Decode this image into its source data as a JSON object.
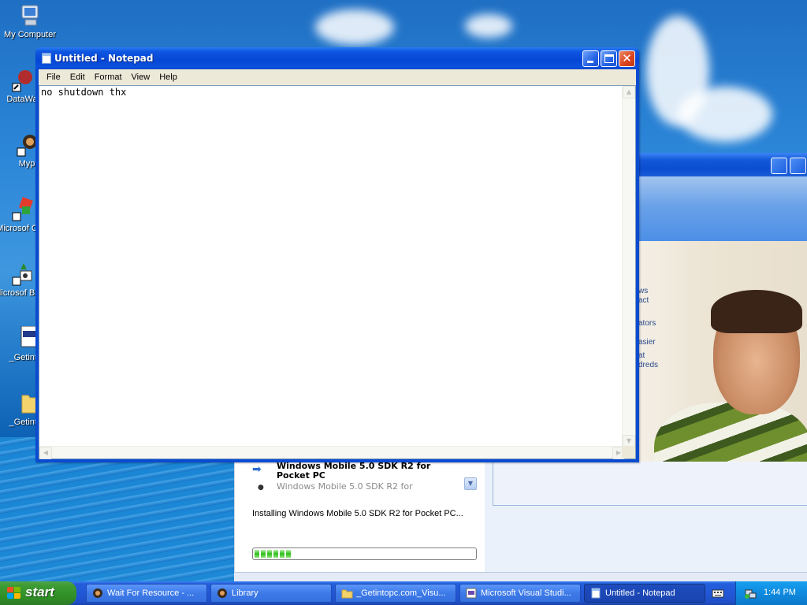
{
  "desktop": {
    "icons": [
      {
        "label": "My Computer"
      },
      {
        "label": "DataWa"
      },
      {
        "label": "Myp"
      },
      {
        "label": "Microsof C++"
      },
      {
        "label": "Microsof Basic"
      },
      {
        "label": "_Getintc"
      },
      {
        "label": "_Getintc"
      }
    ]
  },
  "notepad": {
    "title": "Untitled - Notepad",
    "menu": [
      "File",
      "Edit",
      "Format",
      "View",
      "Help"
    ],
    "content": "no shutdown thx"
  },
  "installer": {
    "partial_text": [
      "ws",
      "act",
      "ators",
      "asier",
      "at",
      "dreds"
    ],
    "item_title": "Windows Mobile 5.0 SDK R2 for Pocket PC",
    "item_subtitle": "Windows Mobile 5.0 SDK R2 for",
    "status": "Installing Windows Mobile 5.0 SDK R2 for Pocket PC...",
    "progress_segments": 6
  },
  "taskbar": {
    "start_label": "start",
    "tasks": [
      {
        "label": "Wait For Resource - ..."
      },
      {
        "label": "Library"
      },
      {
        "label": "_Getintopc.com_Visu..."
      },
      {
        "label": "Microsoft Visual Studi..."
      },
      {
        "label": "Untitled - Notepad"
      }
    ],
    "clock": "1:44 PM"
  },
  "colors": {
    "xp_blue": "#0a4bd2",
    "start_green": "#3c9b32",
    "close_red": "#d9431d"
  }
}
